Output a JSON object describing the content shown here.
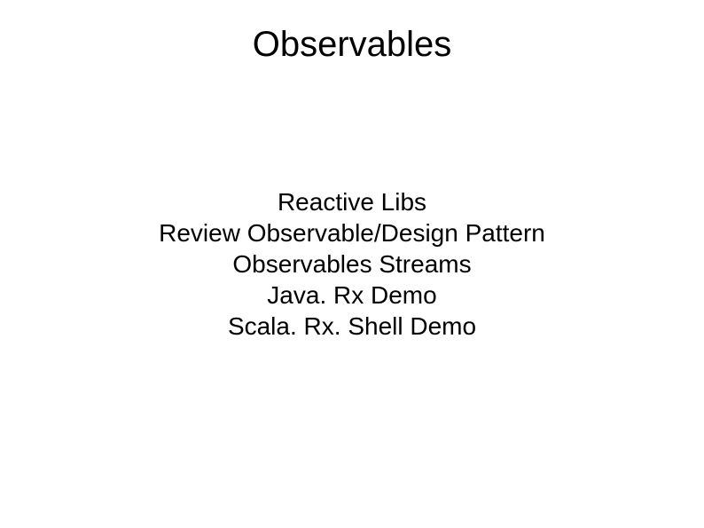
{
  "slide": {
    "title": "Observables",
    "lines": {
      "0": "Reactive Libs",
      "1": "Review Observable/Design Pattern",
      "2": "Observables Streams",
      "3": "Java. Rx Demo",
      "4": "Scala. Rx. Shell Demo"
    }
  }
}
